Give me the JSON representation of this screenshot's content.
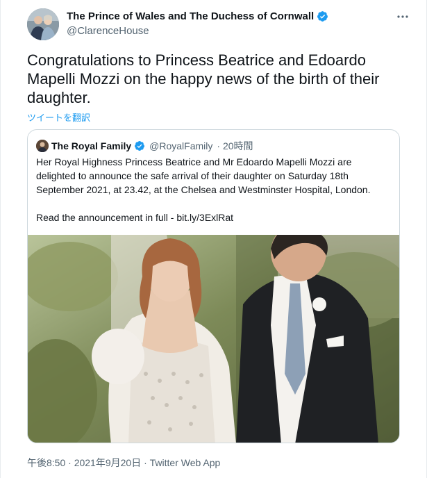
{
  "tweet": {
    "display_name": "The Prince of Wales and The Duchess of Cornwall",
    "handle": "@ClarenceHouse",
    "more_icon": "more-dots-icon",
    "text": "Congratulations to Princess Beatrice and Edoardo Mapelli Mozzi on the happy news of the birth of their daughter.",
    "translate_link": "ツイートを翻訳",
    "timestamp": "午後8:50 · 2021年9月20日 · Twitter Web App",
    "verified_icon": "verified-badge-icon",
    "accent_color": "#1d9bf0"
  },
  "quote": {
    "display_name": "The Royal Family",
    "handle": "@RoyalFamily",
    "time_ago": "· 20時間",
    "body_paragraph_1": "Her Royal Highness Princess Beatrice and Mr Edoardo Mapelli Mozzi are delighted to announce the safe arrival of their daughter on Saturday 18th September 2021, at 23.42, at the Chelsea and Westminster Hospital, London.",
    "body_paragraph_2": "Read the announcement in full - bit.ly/3ExlRat"
  }
}
